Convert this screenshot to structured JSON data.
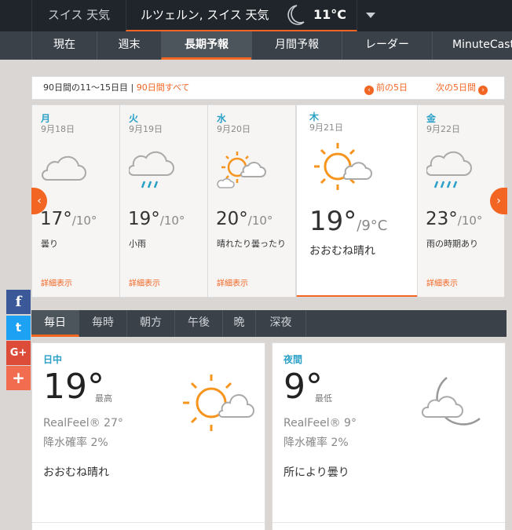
{
  "topbar": {
    "left_tab": "スイス 天気",
    "current_city": "ルツェルン, スイス 天気",
    "current_temp": "11°C"
  },
  "subnav": [
    "現在",
    "週末",
    "長期予報",
    "月間予報",
    "レーダー",
    "MinuteCast"
  ],
  "subnav_active": "長期予報",
  "range": {
    "label": "90日間の11～15日目",
    "separator": "|",
    "all_link": "90日間すべて",
    "prev": "前の5日",
    "next": "次の5日間"
  },
  "days": [
    {
      "dow": "月",
      "date": "9月18日",
      "hi": "17°",
      "lo": "/10°",
      "desc": "曇り",
      "more": "詳細表示",
      "icon": "cloudy-icon"
    },
    {
      "dow": "火",
      "date": "9月19日",
      "hi": "19°",
      "lo": "/10°",
      "desc": "小雨",
      "more": "詳細表示",
      "icon": "light-rain-icon"
    },
    {
      "dow": "水",
      "date": "9月20日",
      "hi": "20°",
      "lo": "/10°",
      "desc": "晴れたり曇ったり",
      "more": "詳細表示",
      "icon": "partly-sunny-icon"
    },
    {
      "dow": "木",
      "date": "9月21日",
      "hi": "19°",
      "lo": "/9°C",
      "desc": "おおむね晴れ",
      "more": "",
      "icon": "mostly-sunny-icon"
    },
    {
      "dow": "金",
      "date": "9月22日",
      "hi": "23°",
      "lo": "/10°",
      "desc": "雨の時期あり",
      "more": "詳細表示",
      "icon": "showers-icon"
    }
  ],
  "period_tabs": [
    "毎日",
    "毎時",
    "朝方",
    "午後",
    "晩",
    "深夜"
  ],
  "period_active": "毎日",
  "day_panel": {
    "label": "日中",
    "temp": "19°",
    "hilo": "最高",
    "realfeel": "RealFeel® 27°",
    "precip": "降水確率 2%",
    "desc": "おおむね晴れ"
  },
  "night_panel": {
    "label": "夜間",
    "temp": "9°",
    "hilo": "最低",
    "realfeel": "RealFeel® 9°",
    "precip": "降水確率 2%",
    "desc": "所により曇り"
  },
  "social": {
    "facebook": "f",
    "twitter": "t",
    "google": "G+",
    "more": "+"
  },
  "colors": {
    "accent": "#f26522",
    "blue": "#2aa0c8",
    "dark": "#1f252b"
  }
}
